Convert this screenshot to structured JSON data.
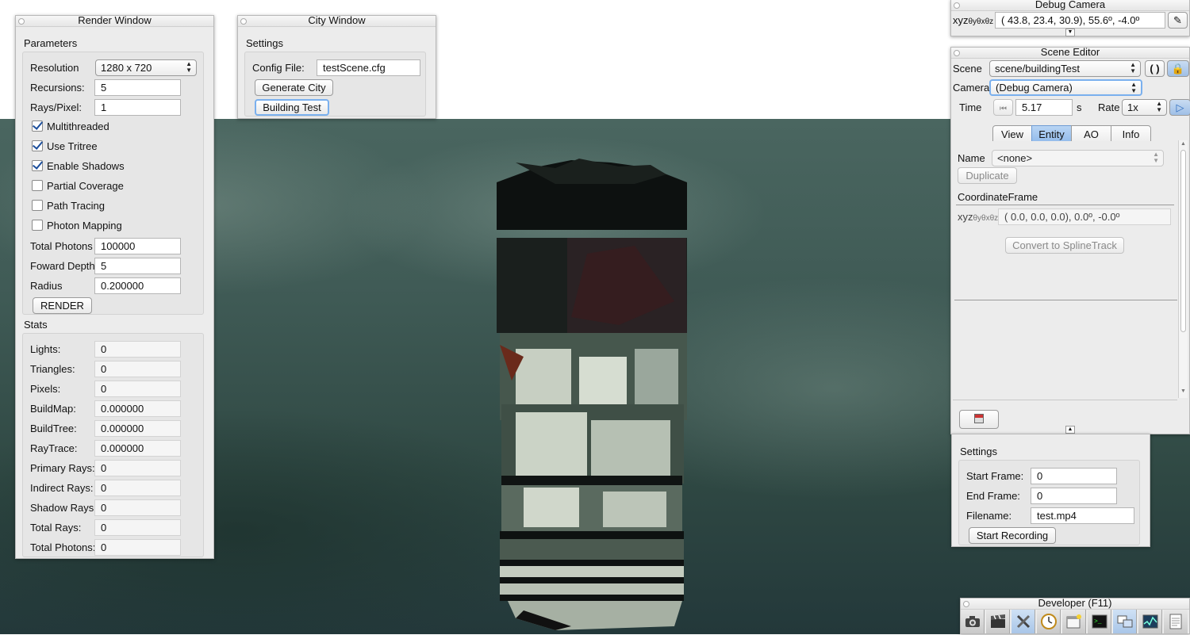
{
  "render_window": {
    "title": "Render Window",
    "parameters_label": "Parameters",
    "params": [
      {
        "label": "Resolution",
        "type": "select",
        "value": "1280 x 720"
      },
      {
        "label": "Recursions:",
        "type": "field",
        "value": "5"
      },
      {
        "label": "Rays/Pixel:",
        "type": "field",
        "value": "1"
      },
      {
        "label": "Multithreaded",
        "type": "checkbox",
        "checked": true
      },
      {
        "label": "Use Tritree",
        "type": "checkbox",
        "checked": true
      },
      {
        "label": "Enable Shadows",
        "type": "checkbox",
        "checked": true
      },
      {
        "label": "Partial Coverage",
        "type": "checkbox",
        "checked": false
      },
      {
        "label": "Path Tracing",
        "type": "checkbox",
        "checked": false
      },
      {
        "label": "Photon Mapping",
        "type": "checkbox",
        "checked": false
      },
      {
        "label": "Total Photons",
        "type": "field",
        "value": "100000"
      },
      {
        "label": "Foward Depth",
        "type": "field",
        "value": "5"
      },
      {
        "label": "Radius",
        "type": "field",
        "value": "0.200000"
      }
    ],
    "render_button": "RENDER",
    "stats_label": "Stats",
    "stats": [
      {
        "label": "Lights:",
        "value": "0"
      },
      {
        "label": "Triangles:",
        "value": "0"
      },
      {
        "label": "Pixels:",
        "value": "0"
      },
      {
        "label": "BuildMap:",
        "value": "0.000000"
      },
      {
        "label": "BuildTree:",
        "value": "0.000000"
      },
      {
        "label": "RayTrace:",
        "value": "0.000000"
      },
      {
        "label": "Primary Rays:",
        "value": "0"
      },
      {
        "label": "Indirect Rays:",
        "value": "0"
      },
      {
        "label": "Shadow Rays:",
        "value": "0"
      },
      {
        "label": "Total Rays:",
        "value": "0"
      },
      {
        "label": "Total Photons:",
        "value": "0"
      }
    ]
  },
  "city_window": {
    "title": "City Window",
    "settings_label": "Settings",
    "config_label": "Config File:",
    "config_value": "testScene.cfg",
    "generate_button": "Generate City",
    "building_test_button": "Building Test"
  },
  "debug_camera": {
    "title": "Debug Camera",
    "xyz_label": "xyz",
    "angle_label": "θyθxθz",
    "coordinates": "( 43.8,  23.4,  30.9),  55.6º,  -4.0º"
  },
  "scene_editor": {
    "title": "Scene Editor",
    "scene_label": "Scene",
    "scene_value": "scene/buildingTest",
    "camera_label": "Camera",
    "camera_value": "(Debug Camera)",
    "time_label": "Time",
    "time_value": "5.17",
    "time_unit": "s",
    "rate_label": "Rate",
    "rate_value": "1x",
    "tabs": [
      "View",
      "Entity",
      "AO",
      "Info"
    ],
    "active_tab": "Entity",
    "name_label": "Name",
    "name_value": "<none>",
    "duplicate_button": "Duplicate",
    "coord_frame_label": "CoordinateFrame",
    "coord_xyz_label": "xyz",
    "coord_angle_label": "θyθxθz",
    "coord_value": "(  0.0,   0.0,   0.0),   0.0º,  -0.0º",
    "convert_button": "Convert to SplineTrack"
  },
  "recording": {
    "settings_label": "Settings",
    "start_frame_label": "Start Frame:",
    "start_frame_value": "0",
    "end_frame_label": "End Frame:",
    "end_frame_value": "0",
    "filename_label": "Filename:",
    "filename_value": "test.mp4",
    "start_button": "Start Recording"
  },
  "developer": {
    "title": "Developer (F11)",
    "tools": [
      "camera-icon",
      "clapperboard-icon",
      "tools-icon",
      "clock-icon",
      "new-window-icon",
      "terminal-icon",
      "windows-icon",
      "graph-icon",
      "document-icon"
    ]
  }
}
